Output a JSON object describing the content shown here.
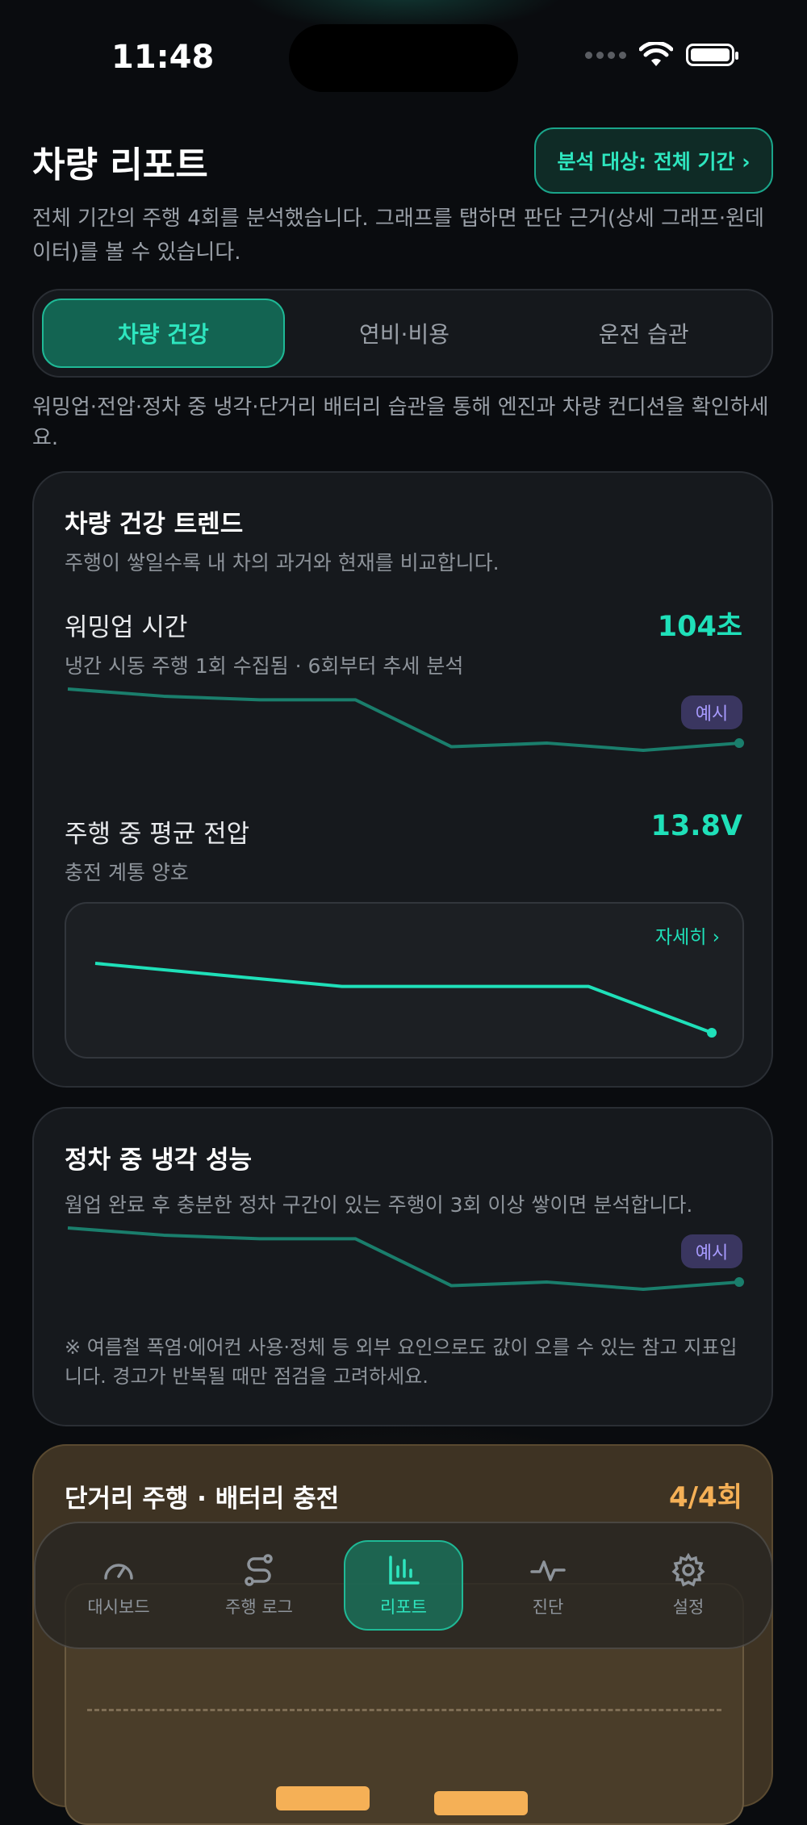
{
  "status": {
    "time": "11:48"
  },
  "header": {
    "title": "차량 리포트",
    "scope_button": "분석 대상: 전체 기간 ›",
    "description": "전체 기간의 주행 4회를 분석했습니다. 그래프를 탭하면 판단 근거(상세 그래프·원데이터)를 볼 수 있습니다."
  },
  "tabs": [
    {
      "label": "차량 건강",
      "active": true
    },
    {
      "label": "연비·비용",
      "active": false
    },
    {
      "label": "운전 습관",
      "active": false
    }
  ],
  "tab_description": "워밍업·전압·정차 중 냉각·단거리 배터리 습관을 통해 엔진과 차량 컨디션을 확인하세요.",
  "health_card": {
    "title": "차량 건강 트렌드",
    "subtitle": "주행이 쌓일수록 내 차의 과거와 현재를 비교합니다.",
    "warmup": {
      "label": "워밍업 시간",
      "value": "104초",
      "note": "냉간 시동 주행 1회 수집됨 · 6회부터 추세 분석",
      "badge": "예시"
    },
    "voltage": {
      "label": "주행 중 평균 전압",
      "value": "13.8V",
      "note": "충전 계통 양호",
      "detail_link": "자세히 ›"
    }
  },
  "cooling_card": {
    "title": "정차 중 냉각 성능",
    "subtitle": "웜업 완료 후 충분한 정차 구간이 있는 주행이 3회 이상 쌓이면 분석합니다.",
    "badge": "예시",
    "note": "※ 여름철 폭염·에어컨 사용·정체 등 외부 요인으로도 값이 오를 수 있는 참고 지표입니다. 경고가 반복될 때만 점검을 고려하세요."
  },
  "short_trip_card": {
    "title": "단거리 주행 · 배터리 충전",
    "value": "4/4회"
  },
  "bottom_nav": [
    {
      "label": "대시보드",
      "icon": "speedometer-icon",
      "active": false
    },
    {
      "label": "주행 로그",
      "icon": "route-icon",
      "active": false
    },
    {
      "label": "리포트",
      "icon": "bar-chart-icon",
      "active": true
    },
    {
      "label": "진단",
      "icon": "pulse-icon",
      "active": false
    },
    {
      "label": "설정",
      "icon": "gear-icon",
      "active": false
    }
  ],
  "colors": {
    "accent": "#1fe0b9",
    "badge_purple": "#a89bff",
    "warning_orange": "#f5b056",
    "background": "#0a0c0f"
  },
  "chart_data": [
    {
      "type": "line",
      "name": "warmup-sample",
      "y": [
        92,
        90,
        89,
        89,
        76,
        77,
        75,
        77
      ]
    },
    {
      "type": "line",
      "name": "voltage",
      "y": [
        14.4,
        14.3,
        14.2,
        14.2,
        14.2,
        13.8
      ]
    },
    {
      "type": "line",
      "name": "cooling-sample",
      "y": [
        92,
        90,
        89,
        89,
        76,
        77,
        75,
        77
      ]
    }
  ]
}
